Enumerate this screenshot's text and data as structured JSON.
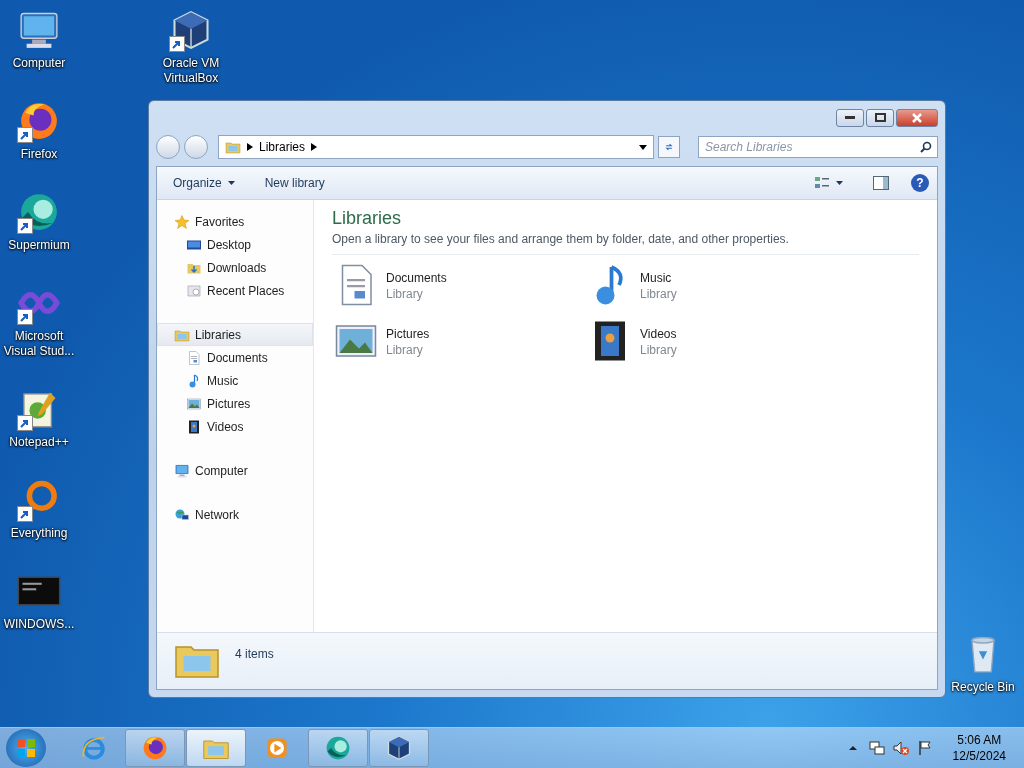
{
  "desktop": {
    "left_column": [
      {
        "label": "Computer",
        "kind": "computer",
        "shortcut": false
      },
      {
        "label": "Firefox",
        "kind": "firefox",
        "shortcut": true
      },
      {
        "label": "Supermium",
        "kind": "supermium",
        "shortcut": true
      },
      {
        "label": "Microsoft Visual Stud...",
        "kind": "vstudio",
        "shortcut": true
      },
      {
        "label": "Notepad++",
        "kind": "notepad",
        "shortcut": true
      },
      {
        "label": "Everything",
        "kind": "everything",
        "shortcut": true
      },
      {
        "label": "WINDOWS...",
        "kind": "console",
        "shortcut": false
      }
    ],
    "second_column": [
      {
        "label": "Oracle VM VirtualBox",
        "kind": "virtualbox",
        "shortcut": true
      }
    ],
    "corner": [
      {
        "label": "Recycle Bin",
        "kind": "recycle",
        "shortcut": false
      }
    ]
  },
  "window": {
    "breadcrumb": [
      "Libraries"
    ],
    "search": {
      "placeholder": "Search Libraries"
    },
    "toolbar": [
      {
        "label": "Organize",
        "dropdown": true
      },
      {
        "label": "New library",
        "dropdown": false
      }
    ],
    "nav_pane": [
      {
        "label": "Favorites",
        "kind": "star",
        "selected": false,
        "children": [
          {
            "label": "Desktop",
            "kind": "desktop",
            "selected": false
          },
          {
            "label": "Downloads",
            "kind": "downloads",
            "selected": false
          },
          {
            "label": "Recent Places",
            "kind": "recent",
            "selected": false
          }
        ]
      },
      {
        "label": "Libraries",
        "kind": "libraries",
        "selected": true,
        "children": [
          {
            "label": "Documents",
            "kind": "documents",
            "selected": false
          },
          {
            "label": "Music",
            "kind": "music",
            "selected": false
          },
          {
            "label": "Pictures",
            "kind": "pictures",
            "selected": false
          },
          {
            "label": "Videos",
            "kind": "videos",
            "selected": false
          }
        ]
      },
      {
        "label": "Computer",
        "kind": "computer",
        "selected": false
      },
      {
        "label": "Network",
        "kind": "network",
        "selected": false
      }
    ],
    "help": "?",
    "content": {
      "title": "Libraries",
      "description": "Open a library to see your files and arrange them by folder, date, and other properties.",
      "items": [
        {
          "name": "Documents",
          "type": "Library",
          "kind": "documents"
        },
        {
          "name": "Music",
          "type": "Library",
          "kind": "music"
        },
        {
          "name": "Pictures",
          "type": "Library",
          "kind": "pictures"
        },
        {
          "name": "Videos",
          "type": "Library",
          "kind": "videos"
        }
      ]
    },
    "details_pane": {
      "count": "4 items"
    }
  },
  "taskbar": {
    "apps": [
      {
        "kind": "ie",
        "running": false,
        "active": false
      },
      {
        "kind": "firefox",
        "running": true,
        "active": false
      },
      {
        "kind": "explorer",
        "running": true,
        "active": true
      },
      {
        "kind": "mediaplayer",
        "running": false,
        "active": false
      },
      {
        "kind": "supermium",
        "running": true,
        "active": false
      },
      {
        "kind": "virtualbox",
        "running": true,
        "active": false
      }
    ],
    "clock": {
      "time": "5:06 AM",
      "date": "12/5/2024"
    }
  }
}
